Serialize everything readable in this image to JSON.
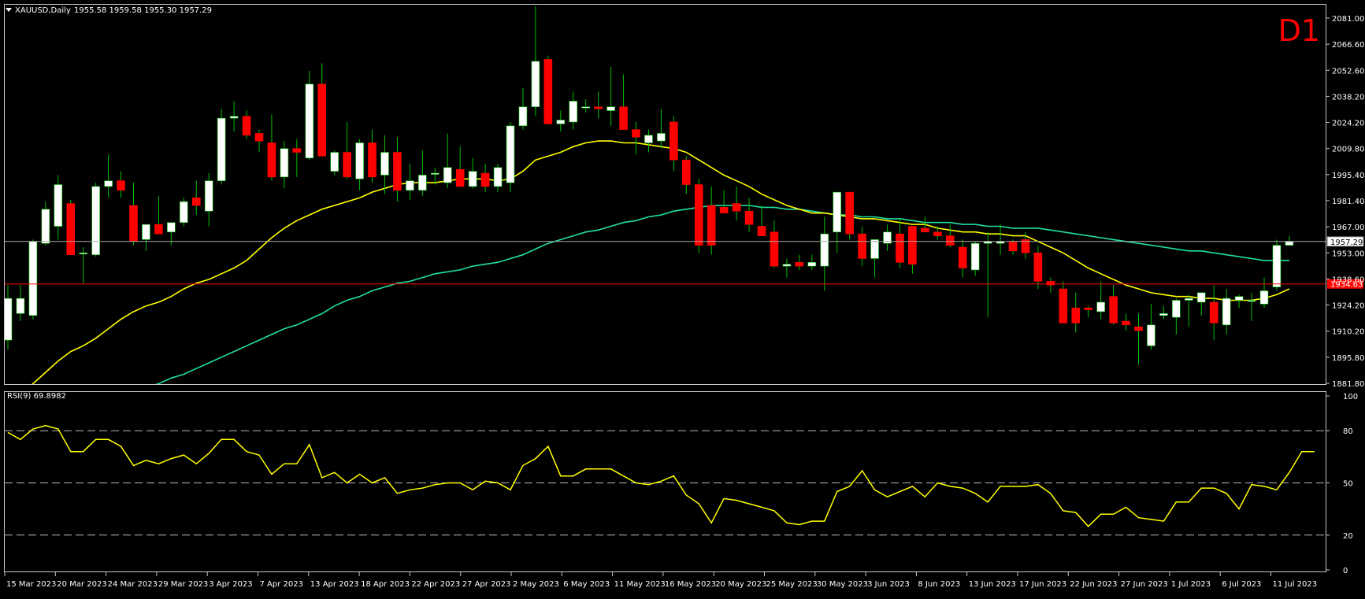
{
  "header": {
    "symbol": "XAUUSD,Daily",
    "ohlc": "1955.58 1959.58 1955.30 1957.29",
    "timeframe_badge": "D1"
  },
  "rsi_header": "RSI(9) 69.8982",
  "colors": {
    "background": "#000000",
    "frame": "#c8c8c8",
    "bull_fill": "#ffffff",
    "bear_fill": "#ff0000",
    "wick": "#00c000",
    "ma_fast": "#ffff00",
    "ma_slow": "#20e0a0",
    "rsi_line": "#ffff00",
    "price_line": "#aaaaaa",
    "level_line": "#ff0000",
    "badge": "#ff0000"
  },
  "chart_data": [
    {
      "type": "candlestick",
      "symbol": "XAUUSD",
      "timeframe": "Daily",
      "ylim": [
        1881.8,
        2081.0
      ],
      "y_ticks": [
        "2081.00",
        "2066.60",
        "2052.60",
        "2038.20",
        "2024.20",
        "2009.80",
        "1995.40",
        "1981.40",
        "1967.00",
        "1953.00",
        "1938.60",
        "1924.20",
        "1910.20",
        "1895.80",
        "1881.80"
      ],
      "current_price_label": "1957.29",
      "level_label": "1934.63",
      "level_value": 1934.63,
      "x_labels": [
        "15 Mar 2023",
        "20 Mar 2023",
        "24 Mar 2023",
        "29 Mar 2023",
        "3 Apr 2023",
        "7 Apr 2023",
        "13 Apr 2023",
        "18 Apr 2023",
        "22 Apr 2023",
        "27 Apr 2023",
        "2 May 2023",
        "6 May 2023",
        "11 May 2023",
        "16 May 2023",
        "20 May 2023",
        "25 May 2023",
        "30 May 2023",
        "3 Jun 2023",
        "8 Jun 2023",
        "13 Jun 2023",
        "17 Jun 2023",
        "22 Jun 2023",
        "27 Jun 2023",
        "1 Jul 2023",
        "6 Jul 2023",
        "11 Jul 2023"
      ],
      "candles": [
        [
          1905,
          1934,
          1900,
          1927
        ],
        [
          1919,
          1934,
          1915,
          1927
        ],
        [
          1918,
          1958,
          1916,
          1957
        ],
        [
          1956,
          1978,
          1955,
          1974
        ],
        [
          1965,
          1992,
          1958,
          1987
        ],
        [
          1977,
          1979,
          1951,
          1950
        ],
        [
          1951,
          1954,
          1935,
          1951
        ],
        [
          1950,
          1988,
          1949,
          1986
        ],
        [
          1986,
          2003,
          1980,
          1989
        ],
        [
          1989,
          1994,
          1980,
          1984
        ],
        [
          1976,
          1988,
          1955,
          1957
        ],
        [
          1958,
          1966,
          1952,
          1966
        ],
        [
          1966,
          1981,
          1962,
          1961
        ],
        [
          1962,
          1966,
          1955,
          1967
        ],
        [
          1967,
          1980,
          1965,
          1978
        ],
        [
          1980,
          1989,
          1971,
          1976
        ],
        [
          1973,
          1993,
          1965,
          1989
        ],
        [
          1989,
          2027,
          1987,
          2022
        ],
        [
          2022,
          2031,
          2015,
          2023
        ],
        [
          2023,
          2026,
          2011,
          2013
        ],
        [
          2014,
          2016,
          2004,
          2010
        ],
        [
          2009,
          2024,
          1989,
          1991
        ],
        [
          1991,
          2010,
          1985,
          2006
        ],
        [
          2006,
          2011,
          1991,
          2004
        ],
        [
          2001,
          2047,
          2000,
          2040
        ],
        [
          2040,
          2051,
          2007,
          2002
        ],
        [
          1994,
          2005,
          1992,
          2004
        ],
        [
          2004,
          2020,
          1990,
          1991
        ],
        [
          1990,
          2011,
          1984,
          2009
        ],
        [
          2009,
          2016,
          1988,
          1991
        ],
        [
          1992,
          2013,
          1982,
          2004
        ],
        [
          2004,
          2012,
          1978,
          1984
        ],
        [
          1984,
          1998,
          1979,
          1989
        ],
        [
          1984,
          2005,
          1981,
          1992
        ],
        [
          1993,
          1996,
          1987,
          1993
        ],
        [
          1988,
          2014,
          1985,
          1996
        ],
        [
          1995,
          2007,
          1986,
          1986
        ],
        [
          1986,
          2001,
          1985,
          1994
        ],
        [
          1993,
          1998,
          1983,
          1986
        ],
        [
          1986,
          1998,
          1983,
          1996
        ],
        [
          1988,
          2020,
          1983,
          2018
        ],
        [
          2018,
          2038,
          2016,
          2028
        ],
        [
          2028,
          2081,
          2023,
          2052
        ],
        [
          2053,
          2055,
          2020,
          2019
        ],
        [
          2019,
          2026,
          2015,
          2021
        ],
        [
          2020,
          2036,
          2016,
          2031
        ],
        [
          2028,
          2032,
          2025,
          2028
        ],
        [
          2028,
          2036,
          2022,
          2027
        ],
        [
          2026,
          2049,
          2018,
          2028
        ],
        [
          2028,
          2045,
          2022,
          2016
        ],
        [
          2016,
          2020,
          2003,
          2012
        ],
        [
          2009,
          2016,
          2004,
          2013
        ],
        [
          2010,
          2027,
          2006,
          2014
        ],
        [
          2020,
          2023,
          1994,
          2000
        ],
        [
          2000,
          2002,
          1982,
          1987
        ],
        [
          1987,
          1990,
          1951,
          1955
        ],
        [
          1976,
          1986,
          1950,
          1955
        ],
        [
          1975,
          1984,
          1972,
          1972
        ],
        [
          1977,
          1986,
          1968,
          1973
        ],
        [
          1973,
          1980,
          1962,
          1966
        ],
        [
          1965,
          1976,
          1960,
          1960
        ],
        [
          1962,
          1968,
          1943,
          1944
        ],
        [
          1944,
          1948,
          1938,
          1945
        ],
        [
          1946,
          1950,
          1942,
          1944
        ],
        [
          1944,
          1950,
          1942,
          1946
        ],
        [
          1944,
          1970,
          1931,
          1961
        ],
        [
          1962,
          1983,
          1951,
          1983
        ],
        [
          1983,
          1983,
          1958,
          1961
        ],
        [
          1961,
          1965,
          1944,
          1948
        ],
        [
          1948,
          1958,
          1938,
          1958
        ],
        [
          1956,
          1966,
          1952,
          1962
        ],
        [
          1961,
          1969,
          1943,
          1946
        ],
        [
          1965,
          1965,
          1940,
          1945
        ],
        [
          1964,
          1970,
          1962,
          1962
        ],
        [
          1962,
          1965,
          1958,
          1960
        ],
        [
          1960,
          1966,
          1954,
          1955
        ],
        [
          1954,
          1958,
          1938,
          1943
        ],
        [
          1942,
          1957,
          1939,
          1956
        ],
        [
          1956,
          1962,
          1917,
          1957
        ],
        [
          1956,
          1966,
          1950,
          1957
        ],
        [
          1957,
          1958,
          1950,
          1952
        ],
        [
          1958,
          1962,
          1948,
          1951
        ],
        [
          1951,
          1955,
          1932,
          1936
        ],
        [
          1936,
          1938,
          1930,
          1934
        ],
        [
          1932,
          1936,
          1914,
          1914
        ],
        [
          1922,
          1930,
          1909,
          1914
        ],
        [
          1922,
          1923,
          1917,
          1921
        ],
        [
          1920,
          1936,
          1916,
          1925
        ],
        [
          1928,
          1934,
          1913,
          1914
        ],
        [
          1915,
          1919,
          1910,
          1913
        ],
        [
          1912,
          1919,
          1892,
          1910
        ],
        [
          1902,
          1924,
          1900,
          1913
        ],
        [
          1918,
          1923,
          1916,
          1919
        ],
        [
          1917,
          1927,
          1908,
          1926
        ],
        [
          1926,
          1929,
          1912,
          1927
        ],
        [
          1925,
          1930,
          1918,
          1930
        ],
        [
          1925,
          1934,
          1905,
          1914
        ],
        [
          1913,
          1932,
          1908,
          1927
        ],
        [
          1926,
          1929,
          1922,
          1928
        ],
        [
          1926,
          1930,
          1915,
          1926
        ],
        [
          1924,
          1938,
          1922,
          1931
        ],
        [
          1933,
          1958,
          1931,
          1955
        ],
        [
          1955,
          1960,
          1955,
          1957
        ]
      ],
      "ma_fast": [
        1872,
        1876,
        1882,
        1888,
        1894,
        1899,
        1902,
        1906,
        1911,
        1916,
        1920,
        1923,
        1925,
        1928,
        1932,
        1935,
        1937,
        1940,
        1943,
        1947,
        1953,
        1959,
        1964,
        1968,
        1971,
        1974,
        1976,
        1978,
        1980,
        1983,
        1985,
        1987,
        1988,
        1988,
        1988,
        1989,
        1990,
        1990,
        1990,
        1989,
        1990,
        1994,
        2000,
        2002,
        2004,
        2007,
        2009,
        2010,
        2010,
        2009,
        2009,
        2008,
        2007,
        2006,
        2004,
        2000,
        1996,
        1992,
        1989,
        1986,
        1982,
        1979,
        1976,
        1974,
        1972,
        1972,
        1971,
        1970,
        1969,
        1969,
        1968,
        1967,
        1966,
        1966,
        1964,
        1963,
        1962,
        1962,
        1961,
        1961,
        1960,
        1960,
        1957,
        1954,
        1951,
        1947,
        1943,
        1940,
        1937,
        1934,
        1932,
        1930,
        1929,
        1928,
        1928,
        1927,
        1927,
        1926,
        1926,
        1926,
        1927,
        1929,
        1932
      ],
      "ma_slow": [
        1853,
        1856,
        1858,
        1861,
        1863,
        1866,
        1869,
        1871,
        1874,
        1876,
        1878,
        1880,
        1882,
        1885,
        1887,
        1890,
        1893,
        1896,
        1899,
        1902,
        1905,
        1908,
        1911,
        1913,
        1916,
        1919,
        1923,
        1926,
        1928,
        1931,
        1933,
        1935,
        1936,
        1938,
        1940,
        1941,
        1942,
        1944,
        1945,
        1946,
        1948,
        1950,
        1953,
        1956,
        1958,
        1960,
        1962,
        1963,
        1965,
        1967,
        1968,
        1970,
        1971,
        1973,
        1974,
        1975,
        1976,
        1976,
        1976,
        1976,
        1975,
        1975,
        1974,
        1974,
        1973,
        1972,
        1971,
        1971,
        1970,
        1970,
        1969,
        1969,
        1968,
        1967,
        1967,
        1967,
        1966,
        1966,
        1965,
        1965,
        1964,
        1964,
        1964,
        1963,
        1962,
        1961,
        1960,
        1959,
        1958,
        1957,
        1956,
        1955,
        1954,
        1953,
        1952,
        1952,
        1951,
        1950,
        1949,
        1948,
        1947,
        1947,
        1947
      ]
    },
    {
      "type": "line",
      "name": "RSI(9)",
      "last_value": "69.8982",
      "ylim": [
        0,
        100
      ],
      "y_ticks": [
        "100",
        "80",
        "50",
        "20",
        "0"
      ],
      "levels": [
        80,
        50,
        20
      ],
      "values": [
        79,
        75,
        81,
        83,
        81,
        68,
        68,
        75,
        75,
        71,
        60,
        63,
        61,
        64,
        66,
        61,
        67,
        75,
        75,
        68,
        66,
        55,
        61,
        61,
        72,
        53,
        56,
        50,
        55,
        50,
        53,
        44,
        46,
        47,
        49,
        50,
        50,
        46,
        51,
        50,
        46,
        60,
        64,
        71,
        54,
        54,
        58,
        58,
        58,
        54,
        50,
        49,
        51,
        54,
        43,
        38,
        27,
        41,
        40,
        38,
        36,
        34,
        27,
        26,
        28,
        28,
        45,
        48,
        57,
        46,
        42,
        45,
        48,
        42,
        50,
        48,
        47,
        44,
        39,
        48,
        48,
        48,
        49,
        44,
        34,
        33,
        25,
        32,
        32,
        36,
        30,
        29,
        28,
        39,
        39,
        47,
        47,
        44,
        35,
        49,
        48,
        46,
        56,
        68,
        68
      ]
    }
  ]
}
